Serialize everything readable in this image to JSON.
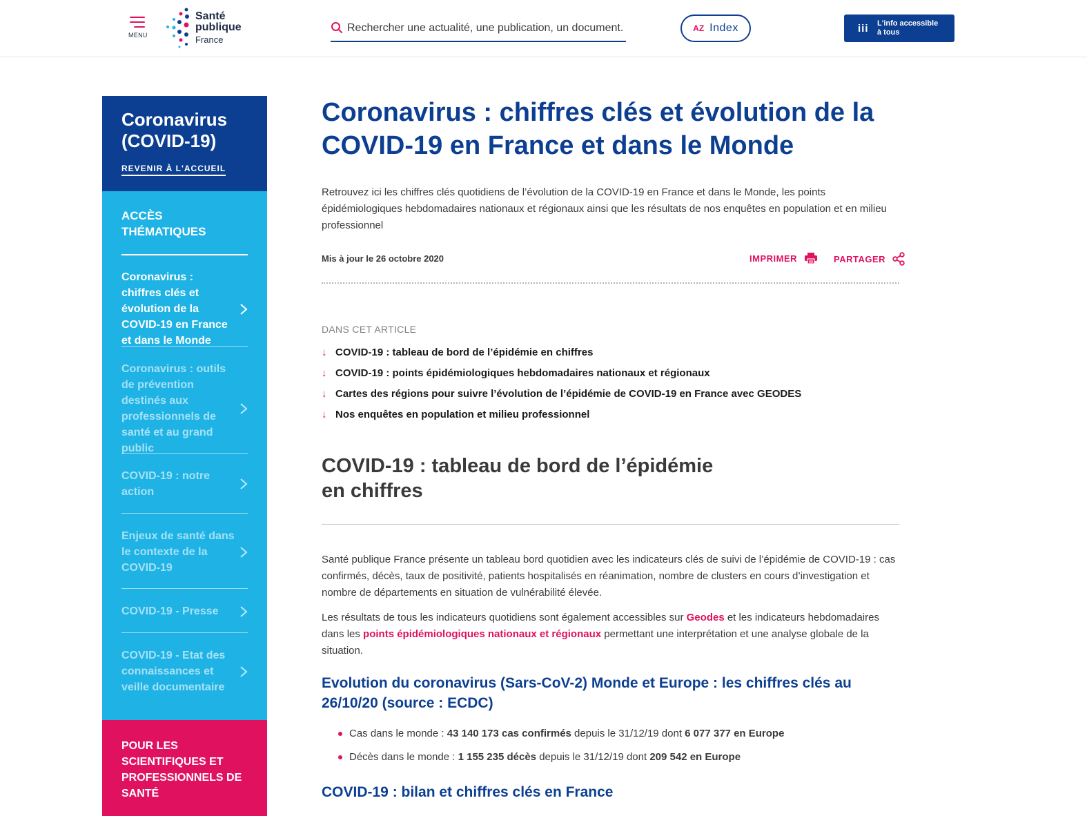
{
  "header": {
    "menu_label": "MENU",
    "logo": {
      "line1": "Santé",
      "line2": "publique",
      "line3": "France"
    },
    "search_placeholder": "Rechercher une actualité, une publication, un document...",
    "index_label": "Index",
    "index_icon_text": "AZ",
    "access_line1": "L'info accessible",
    "access_line2": "à tous",
    "access_icon": "iii"
  },
  "sidebar": {
    "title": "Coronavirus (COVID-19)",
    "back_link": "REVENIR À L'ACCUEIL",
    "section_label": "ACCÈS THÉMATIQUES",
    "items": [
      {
        "label": "Coronavirus : chiffres clés et évolution de la COVID-19 en France et dans le Monde",
        "active": true
      },
      {
        "label": "Coronavirus : outils de prévention destinés aux professionnels de santé et au grand public",
        "active": false
      },
      {
        "label": "COVID-19 : notre action",
        "active": false
      },
      {
        "label": "Enjeux de santé dans le contexte de la COVID-19",
        "active": false
      },
      {
        "label": "COVID-19 - Presse",
        "active": false
      },
      {
        "label": "COVID-19 - Etat des connaissances et veille documentaire",
        "active": false
      }
    ],
    "pro_link": "POUR LES SCIENTIFIQUES ET PROFESSIONNELS DE SANTÉ"
  },
  "article": {
    "title": "Coronavirus : chiffres clés et évolution de la COVID-19 en France et dans le Monde",
    "intro": "Retrouvez ici les chiffres clés quotidiens de l’évolution de la COVID-19 en France et dans le Monde, les points épidémiologiques hebdomadaires nationaux et régionaux ainsi que les résultats de nos enquêtes en population et en milieu professionnel",
    "updated": "Mis à jour le 26 octobre 2020",
    "print_label": "IMPRIMER",
    "share_label": "PARTAGER",
    "toc_label": "DANS CET ARTICLE",
    "toc": [
      "COVID-19 : tableau de bord de l’épidémie en chiffres",
      "COVID-19 : points épidémiologiques hebdomadaires nationaux et régionaux",
      "Cartes des régions pour suivre l’évolution de l’épidémie de COVID-19 en France avec GEODES",
      "Nos enquêtes en population et milieu professionnel"
    ],
    "section_title_line1": "COVID-19 : tableau de bord de l’épidémie",
    "section_title_line2": "en chiffres",
    "paragraph1": "Santé publique France présente un tableau bord quotidien avec les indicateurs clés de suivi de l’épidémie de COVID-19 : cas confirmés, décès, taux de positivité, patients hospitalisés en réanimation, nombre de clusters en cours d’investigation et nombre de départements en situation de vulnérabilité élevée.",
    "paragraph2": {
      "before": "Les résultats de tous les indicateurs quotidiens sont également accessibles sur ",
      "link1": "Geodes",
      "middle": " et les indicateurs hebdomadaires dans les ",
      "link2": "points épidémiologiques nationaux et régionaux",
      "after": " permettant une interprétation et une analyse globale de la situation."
    },
    "subheading1": "Evolution du coronavirus (Sars-CoV-2) Monde et Europe : les chiffres clés au 26/10/20 (source : ECDC)",
    "bullets": [
      {
        "prefix": "Cas dans le monde : ",
        "strong1": "43 140 173 cas confirmés",
        "mid": " depuis le 31/12/19 dont ",
        "strong2": "6 077 377 en Europe"
      },
      {
        "prefix": "Décès dans le monde : ",
        "strong1": "1 155 235 décès",
        "mid": " depuis le 31/12/19 dont ",
        "strong2": "209 542 en Europe"
      }
    ],
    "subheading2": "COVID-19 : bilan et chiffres clés en France"
  },
  "colors": {
    "brand_blue": "#0c3f91",
    "sidebar_cyan": "#1fb3e5",
    "accent_pink": "#e0115f"
  }
}
